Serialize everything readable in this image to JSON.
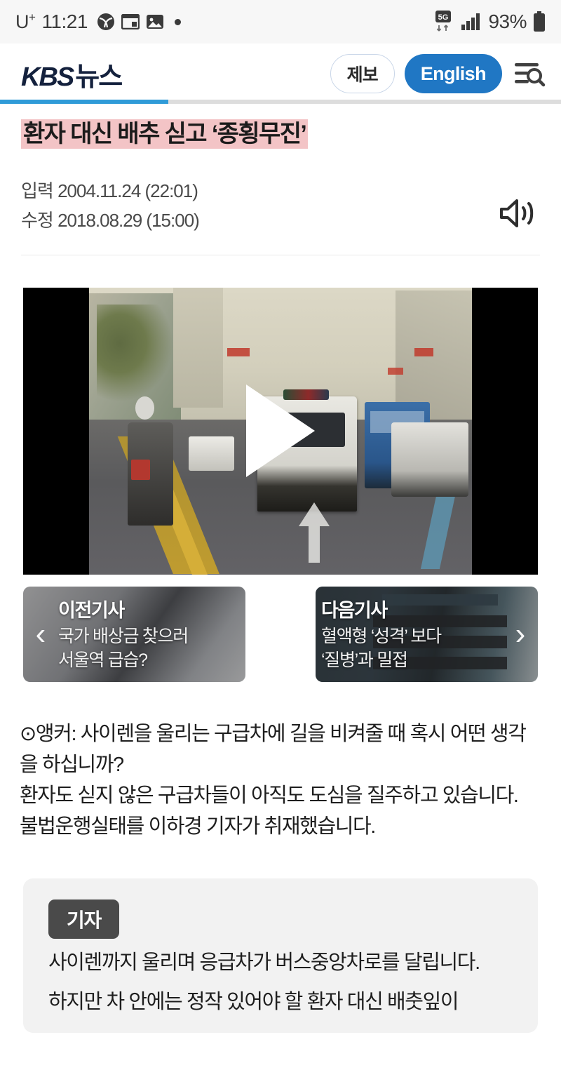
{
  "status_bar": {
    "carrier": "U",
    "carrier_sup": "+",
    "time": "11:21",
    "icons": [
      "app-badge-icon",
      "wallet-icon",
      "photo-icon",
      "dot-icon"
    ],
    "network": "5G",
    "signal": "signal-bars-icon",
    "battery_percent": "93%"
  },
  "header": {
    "logo_kbs": "KBS",
    "logo_news": "뉴스",
    "report_label": "제보",
    "english_label": "English",
    "menu_search_icon": "menu-search-icon",
    "progress_percent": 30,
    "accent_color": "#2077c4",
    "progress_color": "#2f9bd8"
  },
  "article": {
    "title": "환자 대신 배추 싣고 ‘종횡무진’",
    "title_highlight_color": "#f3c4c6",
    "published_label": "입력",
    "published_date": "2004.11.24 (22:01)",
    "updated_label": "수정",
    "updated_date": "2018.08.29 (15:00)",
    "tts_icon": "speaker-icon"
  },
  "video": {
    "play_icon": "play-icon",
    "scene_description": "ambulance-on-city-street"
  },
  "nav_cards": {
    "prev": {
      "chevron": "chevron-left-icon",
      "label": "이전기사",
      "title_line1": "국가 배상금 찾으러",
      "title_line2": "서울역 급습?"
    },
    "next": {
      "chevron": "chevron-right-icon",
      "label": "다음기사",
      "title_line1": "혈액형 ‘성격’ 보다",
      "title_line2": "‘질병’과 밀접"
    }
  },
  "body": {
    "anchor_paragraph_line1": "⊙앵커: 사이렌을 울리는 구급차에 길을 비켜줄 때 혹시 어떤 생각을 하십니까?",
    "anchor_paragraph_line2": "환자도 싣지 않은 구급차들이 아직도 도심을 질주하고 있습니다.",
    "anchor_paragraph_line3": "불법운행실태를 이하경 기자가 취재했습니다."
  },
  "reporter": {
    "badge": "기자",
    "text_line1": "사이렌까지 울리며 응급차가 버스중앙차로를 달립니다.",
    "text_line2": "하지만 차 안에는 정작 있어야 할 환자 대신 배춧잎이"
  }
}
